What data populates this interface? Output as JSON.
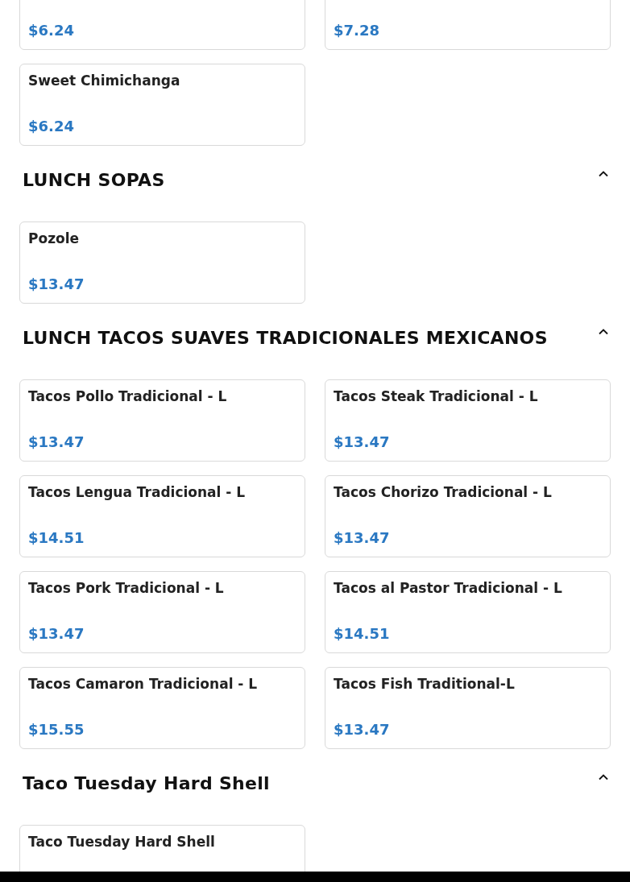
{
  "sections": [
    {
      "items": [
        {
          "price": "$6.24"
        },
        {
          "price": "$7.28"
        },
        {
          "name": "Sweet Chimichanga",
          "price": "$6.24"
        }
      ]
    },
    {
      "title": "LUNCH SOPAS",
      "expanded": true,
      "items": [
        {
          "name": "Pozole",
          "price": "$13.47"
        }
      ]
    },
    {
      "title": "LUNCH TACOS SUAVES TRADICIONALES MEXICANOS",
      "expanded": true,
      "items": [
        {
          "name": "Tacos Pollo Tradicional - L",
          "price": "$13.47"
        },
        {
          "name": "Tacos Steak Tradicional - L",
          "price": "$13.47"
        },
        {
          "name": "Tacos Lengua Tradicional - L",
          "price": "$14.51"
        },
        {
          "name": "Tacos Chorizo Tradicional - L",
          "price": "$13.47"
        },
        {
          "name": "Tacos Pork Tradicional - L",
          "price": "$13.47"
        },
        {
          "name": "Tacos al Pastor Tradicional - L",
          "price": "$14.51"
        },
        {
          "name": "Tacos Camaron Tradicional - L",
          "price": "$15.55"
        },
        {
          "name": "Tacos Fish Traditional-L",
          "price": "$13.47"
        }
      ]
    },
    {
      "title": "Taco Tuesday Hard Shell",
      "expanded": true,
      "items": [
        {
          "name": "Taco Tuesday Hard Shell"
        }
      ]
    }
  ]
}
